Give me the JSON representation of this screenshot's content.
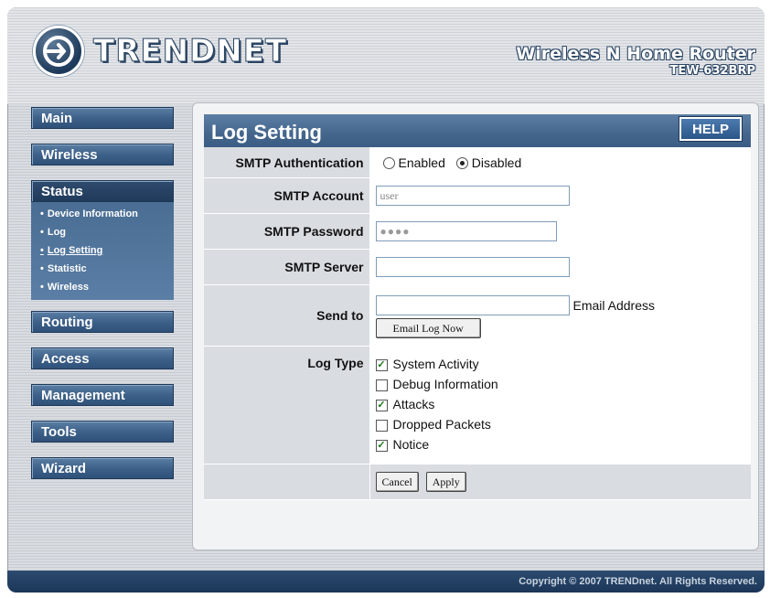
{
  "brand": {
    "logo_text": "TRENDNET",
    "product_name": "Wireless N Home Router",
    "model": "TEW-632BRP"
  },
  "sidebar": {
    "items": [
      {
        "label": "Main"
      },
      {
        "label": "Wireless"
      },
      {
        "label": "Status"
      },
      {
        "label": "Routing"
      },
      {
        "label": "Access"
      },
      {
        "label": "Management"
      },
      {
        "label": "Tools"
      },
      {
        "label": "Wizard"
      }
    ],
    "status_sub": [
      {
        "label": "Device Information"
      },
      {
        "label": "Log"
      },
      {
        "label": "Log Setting"
      },
      {
        "label": "Statistic"
      },
      {
        "label": "Wireless"
      }
    ]
  },
  "panel": {
    "title": "Log Setting",
    "help_label": "HELP"
  },
  "form": {
    "smtp_auth_label": "SMTP Authentication",
    "enabled_label": "Enabled",
    "disabled_label": "Disabled",
    "auth_selected": "Disabled",
    "smtp_account_label": "SMTP Account",
    "smtp_account_value": "user",
    "smtp_password_label": "SMTP Password",
    "smtp_password_value": "●●●●",
    "smtp_server_label": "SMTP Server",
    "smtp_server_value": "",
    "send_to_label": "Send to",
    "send_to_value": "",
    "email_address_label": "Email Address",
    "email_log_now_label": "Email Log Now",
    "log_type_label": "Log Type",
    "log_types": [
      {
        "label": "System Activity",
        "checked": true
      },
      {
        "label": "Debug Information",
        "checked": false
      },
      {
        "label": "Attacks",
        "checked": true
      },
      {
        "label": "Dropped Packets",
        "checked": false
      },
      {
        "label": "Notice",
        "checked": true
      }
    ],
    "cancel_label": "Cancel",
    "apply_label": "Apply"
  },
  "footer": {
    "copyright": "Copyright © 2007 TRENDnet. All Rights Reserved."
  }
}
